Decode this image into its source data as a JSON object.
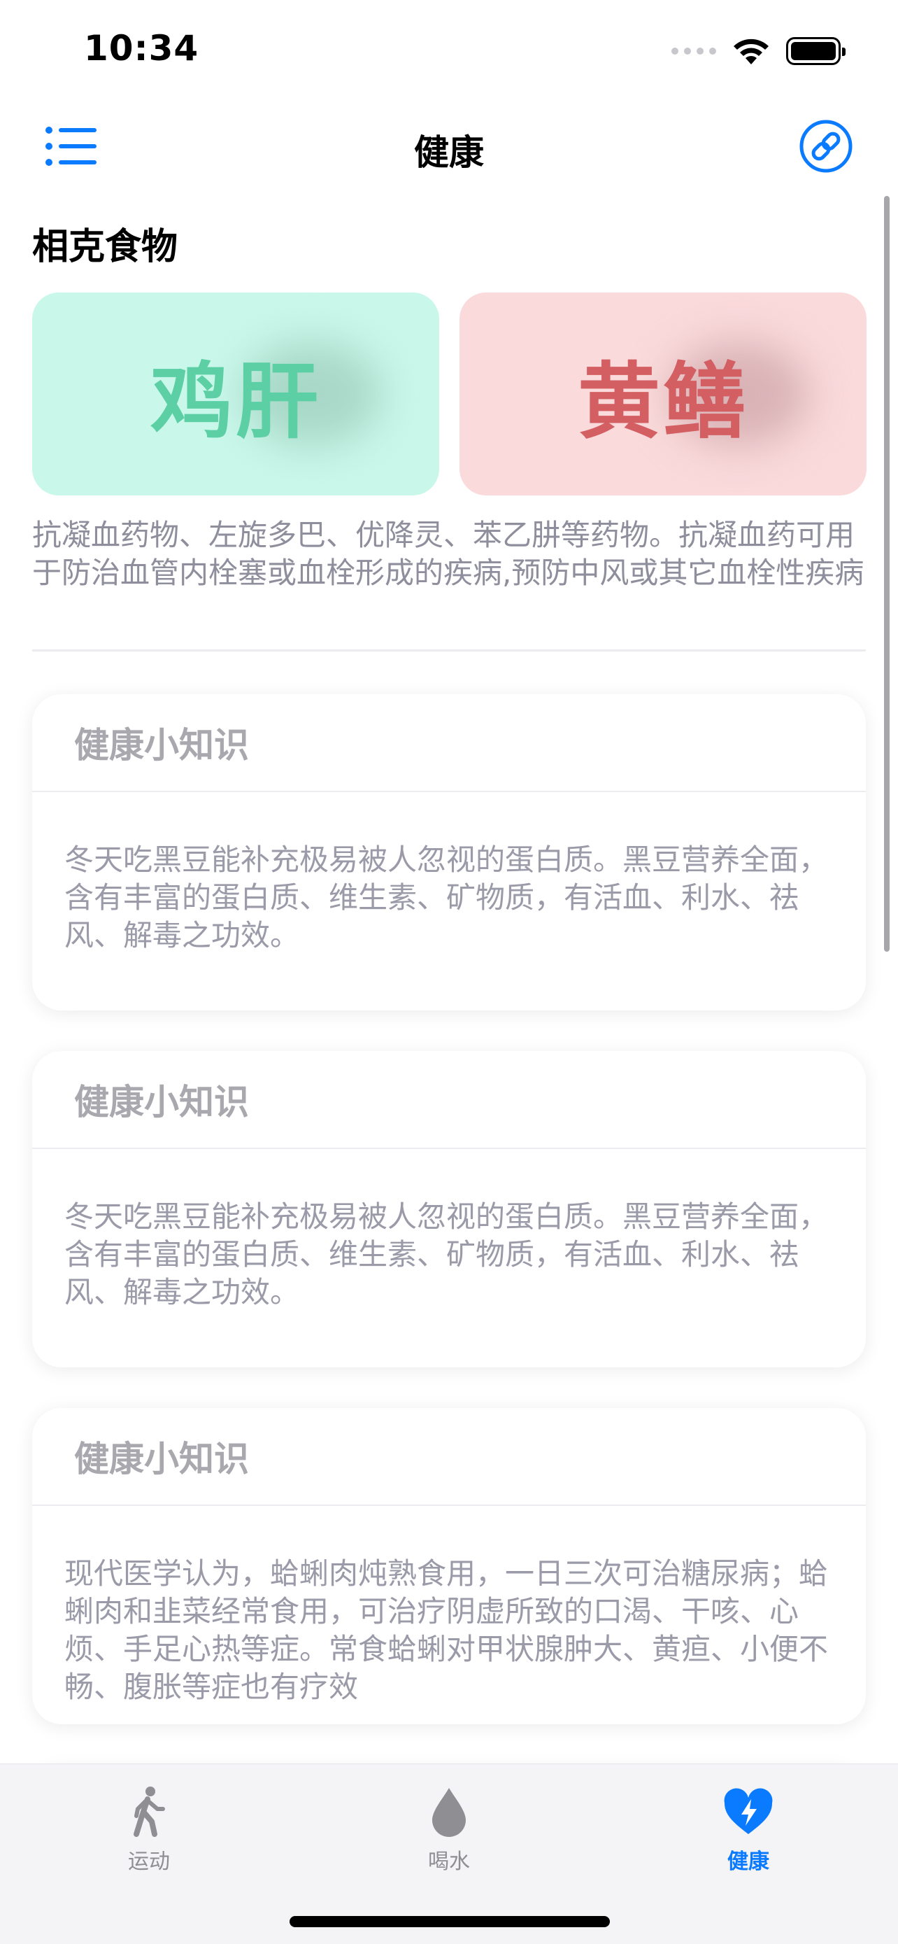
{
  "status_bar": {
    "time": "10:34"
  },
  "nav": {
    "title": "健康"
  },
  "section": {
    "title": "相克食物"
  },
  "food_pair": {
    "left": "鸡肝",
    "right": "黄鳝",
    "description": "抗凝血药物、左旋多巴、优降灵、苯乙肼等药物。抗凝血药可用于防治血管内栓塞或血栓形成的疾病,预防中风或其它血栓性疾病"
  },
  "tips": [
    {
      "title": "健康小知识",
      "body": "冬天吃黑豆能补充极易被人忽视的蛋白质。黑豆营养全面，含有丰富的蛋白质、维生素、矿物质，有活血、利水、祛风、解毒之功效。"
    },
    {
      "title": "健康小知识",
      "body": "冬天吃黑豆能补充极易被人忽视的蛋白质。黑豆营养全面，含有丰富的蛋白质、维生素、矿物质，有活血、利水、祛风、解毒之功效。"
    },
    {
      "title": "健康小知识",
      "body": "现代医学认为，蛤蜊肉炖熟食用，一日三次可治糖尿病；蛤蜊肉和韭菜经常食用，可治疗阴虚所致的口渴、干咳、心烦、手足心热等症。常食蛤蜊对甲状腺肿大、黄疸、小便不畅、腹胀等症也有疗效"
    }
  ],
  "tab_bar": {
    "items": [
      {
        "label": "运动",
        "icon": "walking-icon"
      },
      {
        "label": "喝水",
        "icon": "water-drop-icon"
      },
      {
        "label": "健康",
        "icon": "heart-bolt-icon"
      }
    ],
    "active": "健康"
  },
  "colors": {
    "accent": "#0a7aff",
    "left_card_bg": "#c9f8ea",
    "left_card_text": "#5ccfa5",
    "right_card_bg": "#fadadb",
    "right_card_text": "#d35f63"
  }
}
